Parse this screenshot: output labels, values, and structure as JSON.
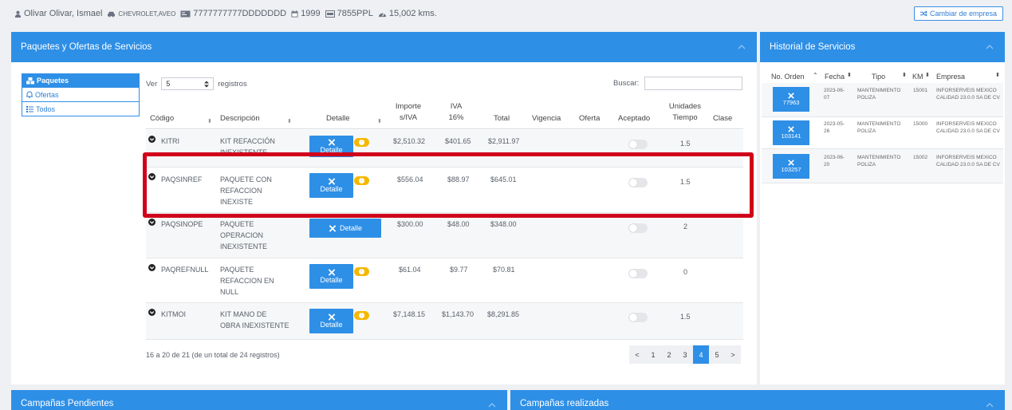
{
  "header": {
    "customer": "Olivar Olivar, Ismael",
    "vehicle": "CHEVROLET,AVEO",
    "vin": "7777777777DDDDDDD",
    "year": "1999",
    "plate": "7855PPL",
    "mileage": "15,002 kms.",
    "change_company_label": "Cambiar de empresa"
  },
  "packages_panel": {
    "title": "Paquetes y Ofertas de Servicios",
    "tabs": [
      "Paquetes",
      "Ofertas",
      "Todos"
    ],
    "show_label": "Ver",
    "show_value": "5",
    "records_label": "registros",
    "search_label": "Buscar:",
    "columns": [
      "Código",
      "Descripción",
      "Detalle",
      "Importe s/IVA",
      "IVA 16%",
      "Total",
      "Vigencia",
      "Oferta",
      "Aceptado",
      "Unidades Tiempo",
      "Clase"
    ],
    "detail_label": "Detalle",
    "rows": [
      {
        "code": "KITRI",
        "desc": [
          "KIT REFACCIÓN",
          "INEXISTENTE"
        ],
        "importe": "$2,510.32",
        "iva": "$401.65",
        "total": "$2,911.97",
        "time": "1.5"
      },
      {
        "code": "PAQSINREF",
        "desc": [
          "PAQUETE CON",
          "REFACCION",
          "INEXISTE"
        ],
        "importe": "$556.04",
        "iva": "$88.97",
        "total": "$645.01",
        "time": "1.5"
      },
      {
        "code": "PAQSINOPE",
        "desc": [
          "PAQUETE",
          "OPERACION",
          "INEXISTENTE"
        ],
        "importe": "$300.00",
        "iva": "$48.00",
        "total": "$348.00",
        "time": "2"
      },
      {
        "code": "PAQREFNULL",
        "desc": [
          "PAQUETE",
          "REFACCION EN",
          "NULL"
        ],
        "importe": "$61.04",
        "iva": "$9.77",
        "total": "$70.81",
        "time": "0"
      },
      {
        "code": "KITMOI",
        "desc": [
          "KIT MANO DE",
          "OBRA INEXISTENTE"
        ],
        "importe": "$7,148.15",
        "iva": "$1,143.70",
        "total": "$8,291.85",
        "time": "1.5"
      }
    ],
    "footer_info": "16 a 20 de 21 (de un total de 24 registros)",
    "pages": [
      "<",
      "1",
      "2",
      "3",
      "4",
      "5",
      ">"
    ],
    "active_page": "4"
  },
  "history_panel": {
    "title": "Historial de Servicios",
    "columns": [
      "No. Orden",
      "Fecha",
      "Tipo",
      "KM",
      "Empresa"
    ],
    "rows": [
      {
        "order": "77963",
        "date": [
          "2023-06-",
          "07"
        ],
        "type": [
          "MANTENIMIENTO",
          "POLIZA"
        ],
        "km": "15001",
        "company": [
          "INFORSERVEIS MEXICO",
          "CALIDAD 23.0.0 SA DE CV"
        ]
      },
      {
        "order": "103141",
        "date": [
          "2023-05-",
          "26"
        ],
        "type": [
          "MANTENIMIENTO",
          "POLIZA"
        ],
        "km": "15000",
        "company": [
          "INFORSERVEIS MEXICO",
          "CALIDAD 23.0.0 SA DE CV"
        ]
      },
      {
        "order": "103257",
        "date": [
          "2023-06-",
          "20"
        ],
        "type": [
          "MANTENIMIENTO",
          "POLIZA"
        ],
        "km": "15002",
        "company": [
          "INFORSERVEIS MEXICO",
          "CALIDAD 23.0.0 SA DE CV"
        ]
      }
    ]
  },
  "bottom_panels": {
    "pending": "Campañas Pendientes",
    "done": "Campañas realizadas"
  },
  "colors": {
    "primary": "#2e8fe6",
    "highlight": "#d0021b",
    "badge": "#f5b800"
  }
}
